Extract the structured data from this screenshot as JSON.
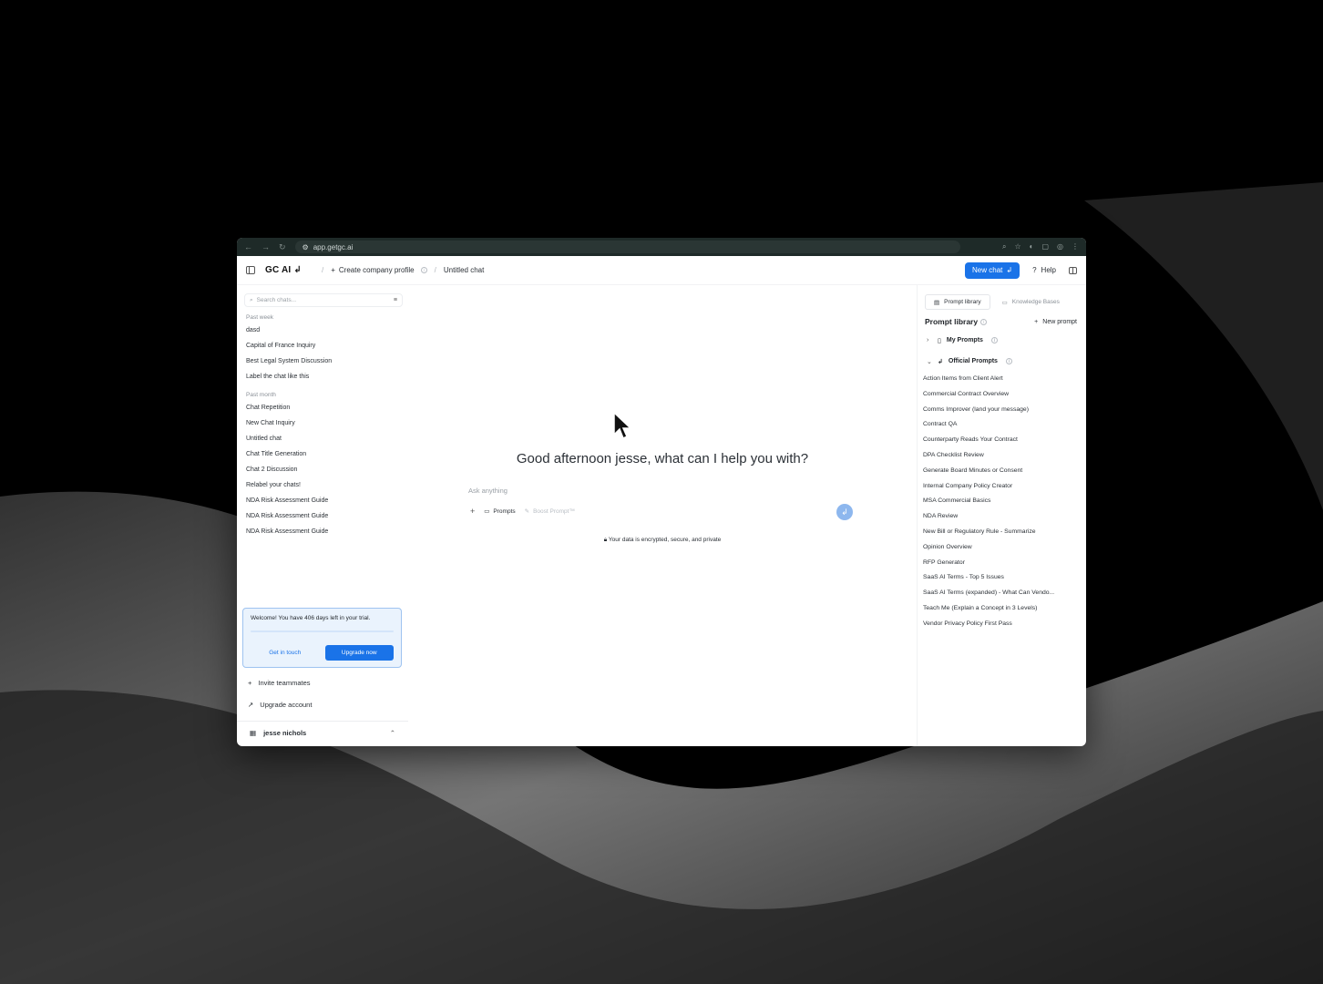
{
  "browser": {
    "url": "app.getgc.ai"
  },
  "header": {
    "logo": "GC AI",
    "logo_mark": "↲",
    "crumb_1": "Create company profile",
    "crumb_2": "Untitled chat",
    "new_chat_label": "New chat",
    "help_label": "Help"
  },
  "sidebar": {
    "search_placeholder": "Search chats...",
    "groups": [
      {
        "label": "Past week",
        "items": [
          "dasd",
          "Capital of France Inquiry",
          "Best Legal System Discussion",
          "Label the chat like this"
        ]
      },
      {
        "label": "Past month",
        "items": [
          "Chat Repetition",
          "New Chat Inquiry",
          "Untitled chat",
          "Chat Title Generation",
          "Chat 2 Discussion",
          "Relabel your chats!",
          "NDA Risk Assessment Guide",
          "NDA Risk Assessment Guide",
          "NDA Risk Assessment Guide"
        ]
      }
    ],
    "trial": {
      "text": "Welcome! You have 406 days left in your trial.",
      "get_in_touch": "Get in touch",
      "upgrade": "Upgrade now"
    },
    "invite_label": "Invite teammates",
    "upgrade_account_label": "Upgrade account",
    "user_name": "jesse nichols"
  },
  "main": {
    "greeting": "Good afternoon jesse, what can I help you with?",
    "ask_placeholder": "Ask anything",
    "prompts_label": "Prompts",
    "boost_label": "Boost Prompt™",
    "secure_note": "Your data is encrypted, secure, and private"
  },
  "right_panel": {
    "tab_prompt_library": "Prompt library",
    "tab_knowledge_bases": "Knowledge Bases",
    "title": "Prompt library",
    "new_prompt": "New prompt",
    "my_prompts": "My Prompts",
    "official_prompts": "Official Prompts",
    "prompts": [
      "Action Items from Client Alert",
      "Commercial Contract Overview",
      "Comms Improver (land your message)",
      "Contract QA",
      "Counterparty Reads Your Contract",
      "DPA Checklist Review",
      "Generate Board Minutes or Consent",
      "Internal Company Policy Creator",
      "MSA Commercial Basics",
      "NDA Review",
      "New Bill or Regulatory Rule - Summarize",
      "Opinion Overview",
      "RFP Generator",
      "SaaS AI Terms - Top 5 Issues",
      "SaaS AI Terms (expanded) - What Can Vendo...",
      "Teach Me (Explain a Concept in 3 Levels)",
      "Vendor Privacy Policy First Pass"
    ]
  },
  "colors": {
    "accent": "#1a73e8",
    "trial_bg": "#eaf3fd"
  }
}
